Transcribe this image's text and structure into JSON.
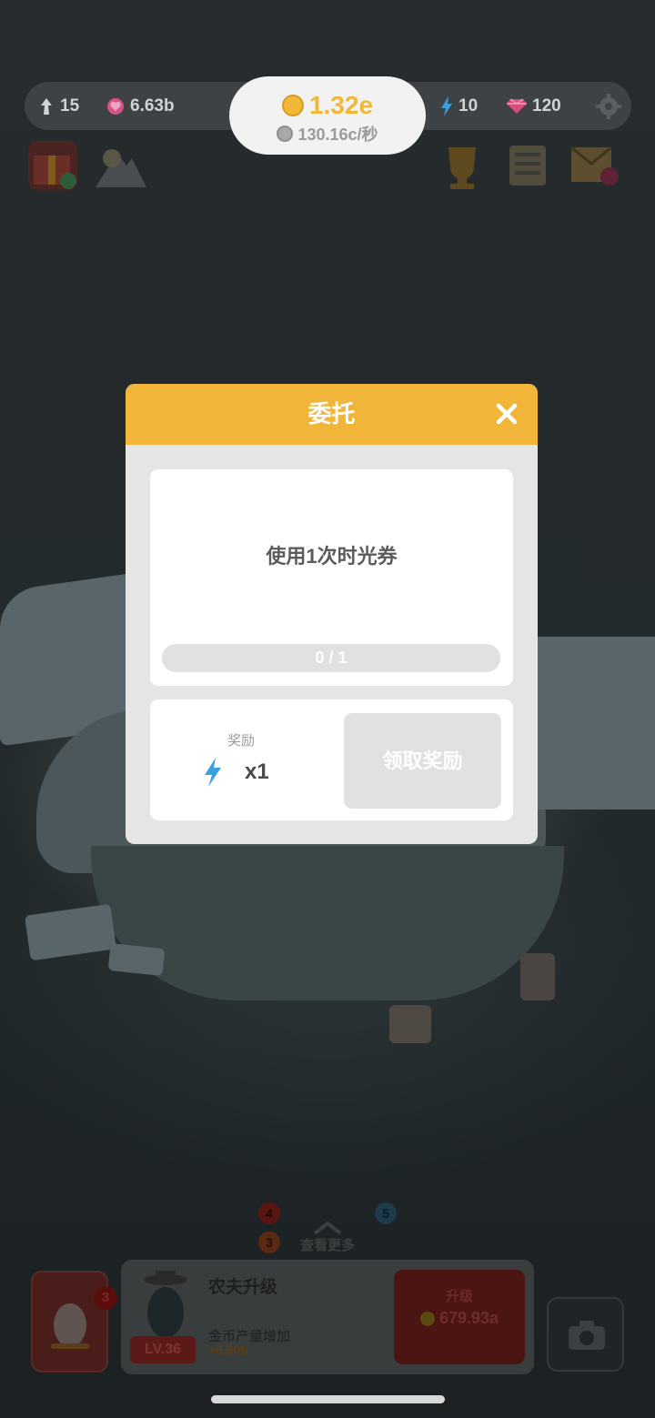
{
  "hud": {
    "penguins": "15",
    "hearts": "6.63b",
    "coins": "1.32e",
    "coin_rate": "130.16c/秒",
    "energy": "10",
    "gems": "120"
  },
  "dialog": {
    "title": "委托",
    "task": "使用1次时光券",
    "progress_text": "0 / 1",
    "progress_fraction": 0,
    "reward_label": "奖励",
    "reward_count": "x1",
    "claim_label": "领取奖励"
  },
  "bottom": {
    "more_label": "查看更多",
    "badge_4": "4",
    "badge_3": "3",
    "badge_5": "5",
    "egg_badge": "3",
    "upgrade_title": "农夫升级",
    "upgrade_desc": "金币产量增加",
    "upgrade_bonus": "+6.60b",
    "level": "LV.36",
    "upgrade_label": "升级",
    "upgrade_cost": "679.93a"
  },
  "colors": {
    "header": "#f1b53a",
    "coin": "#f0b836",
    "energy": "#3aa0e0"
  }
}
